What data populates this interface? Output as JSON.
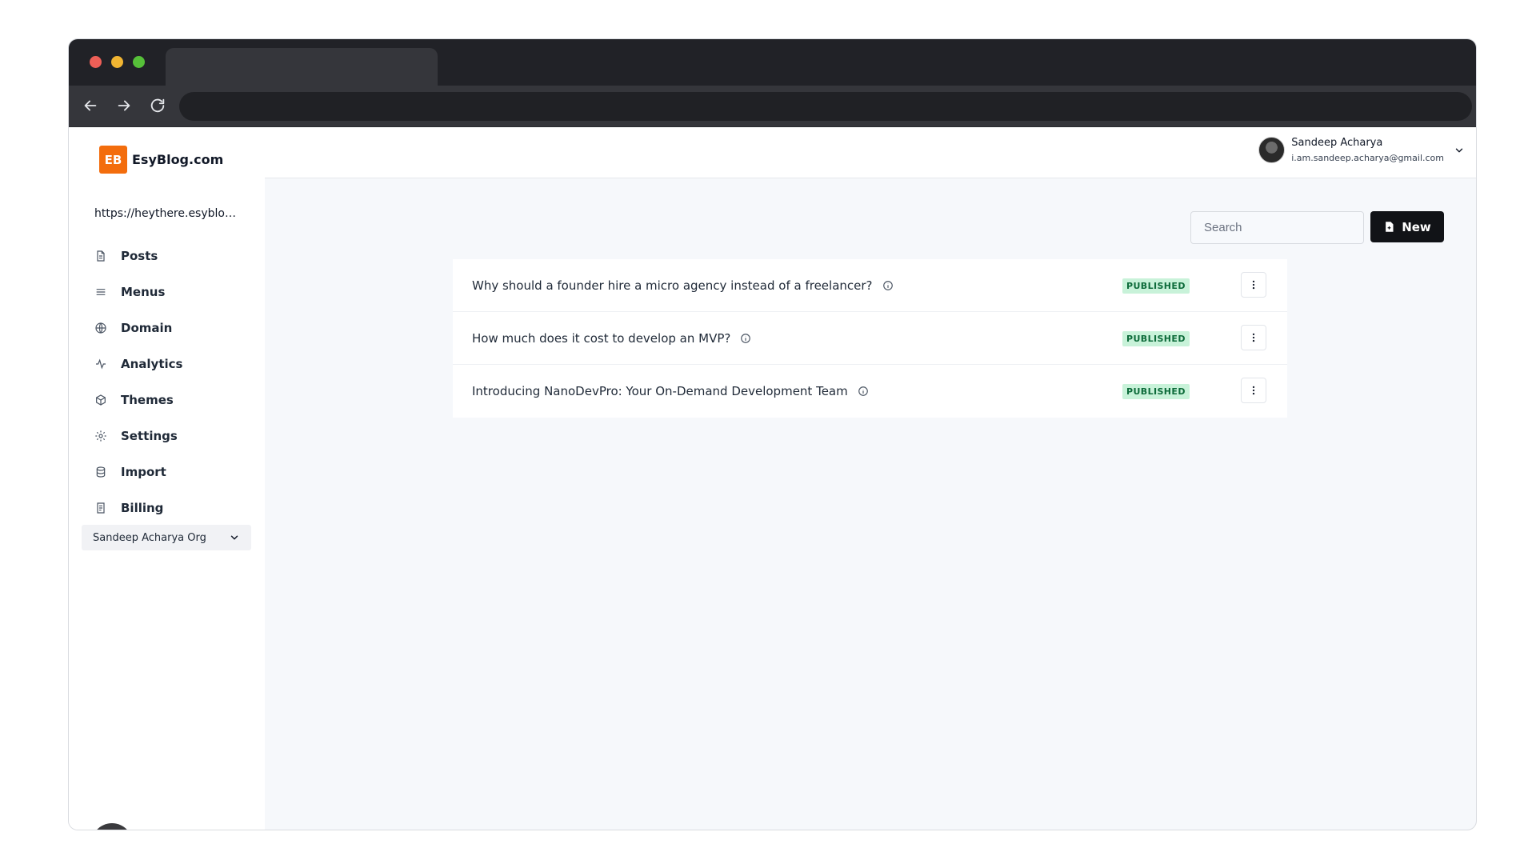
{
  "brand": {
    "badge": "EB",
    "name": "EsyBlog.com",
    "badge_color": "#f36d0d"
  },
  "sidebar": {
    "site_url": "https://heythere.esyblog...",
    "items": [
      {
        "label": "Posts",
        "icon": "document-icon"
      },
      {
        "label": "Menus",
        "icon": "menu-icon"
      },
      {
        "label": "Domain",
        "icon": "globe-icon"
      },
      {
        "label": "Analytics",
        "icon": "activity-icon"
      },
      {
        "label": "Themes",
        "icon": "cube-icon"
      },
      {
        "label": "Settings",
        "icon": "gear-icon"
      },
      {
        "label": "Import",
        "icon": "database-icon"
      },
      {
        "label": "Billing",
        "icon": "receipt-icon"
      }
    ],
    "org_select": "Sandeep Acharya Org"
  },
  "user": {
    "name": "Sandeep Acharya",
    "email": "i.am.sandeep.acharya@gmail.com"
  },
  "toolbar": {
    "search_placeholder": "Search",
    "new_label": "New"
  },
  "posts": [
    {
      "title": "Why should a founder hire a micro agency instead of a freelancer?",
      "status": "PUBLISHED"
    },
    {
      "title": "How much does it cost to develop an MVP?",
      "status": "PUBLISHED"
    },
    {
      "title": "Introducing NanoDevPro: Your On-Demand Development Team",
      "status": "PUBLISHED"
    }
  ],
  "colors": {
    "status_published_bg": "#c8f2d9",
    "status_published_text": "#0d6b3a",
    "primary_button": "#111317"
  }
}
